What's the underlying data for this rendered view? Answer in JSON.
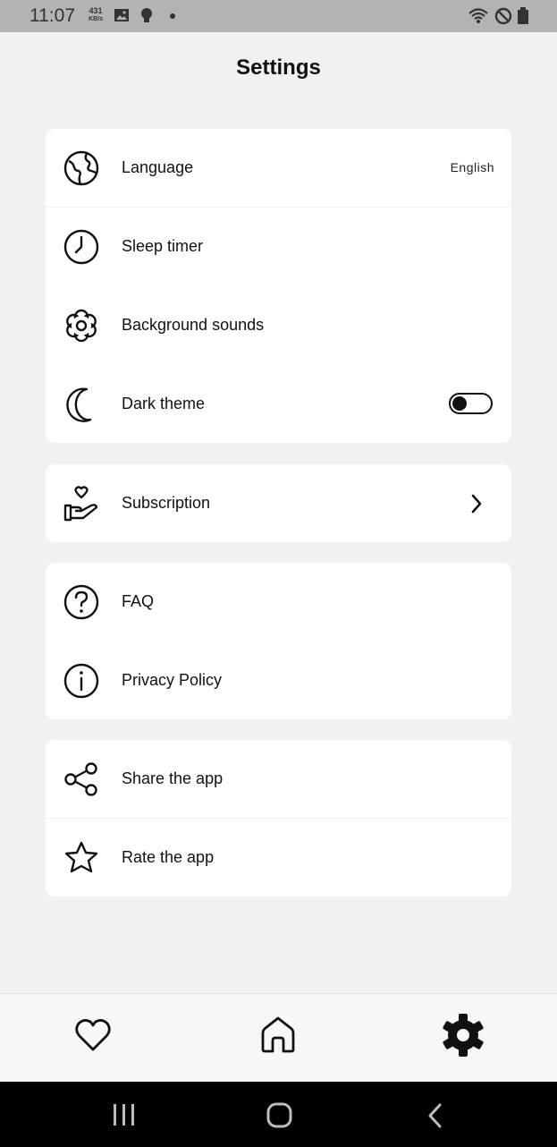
{
  "status_bar": {
    "time": "11:07",
    "speed_value": "431",
    "speed_unit": "KB/s",
    "icons": [
      "image-icon",
      "bulb-icon",
      "dot-icon",
      "wifi-icon",
      "do-not-disturb-icon",
      "battery-icon"
    ]
  },
  "page": {
    "title": "Settings"
  },
  "group1": {
    "language": {
      "label": "Language",
      "value": "English",
      "icon": "globe-icon"
    },
    "sleep_timer": {
      "label": "Sleep timer",
      "icon": "clock-icon"
    },
    "background_sounds": {
      "label": "Background sounds",
      "icon": "flower-gear-icon"
    },
    "dark_theme": {
      "label": "Dark theme",
      "icon": "moon-icon",
      "enabled": false
    }
  },
  "group2": {
    "subscription": {
      "label": "Subscription",
      "icon": "hand-heart-icon"
    }
  },
  "group3": {
    "faq": {
      "label": "FAQ",
      "icon": "question-icon"
    },
    "privacy": {
      "label": "Privacy Policy",
      "icon": "info-icon"
    }
  },
  "group4": {
    "share": {
      "label": "Share the app",
      "icon": "share-icon"
    },
    "rate": {
      "label": "Rate the app",
      "icon": "star-icon"
    }
  },
  "bottom_nav": {
    "items": [
      "heart-icon",
      "home-icon",
      "settings-icon"
    ],
    "active": "settings-icon"
  },
  "system_nav": [
    "recents-icon",
    "home-button-icon",
    "back-icon"
  ],
  "colors": {
    "background": "#f1f1f1",
    "card": "#ffffff",
    "ink": "#111111",
    "status_bar": "#b3b3b3"
  }
}
